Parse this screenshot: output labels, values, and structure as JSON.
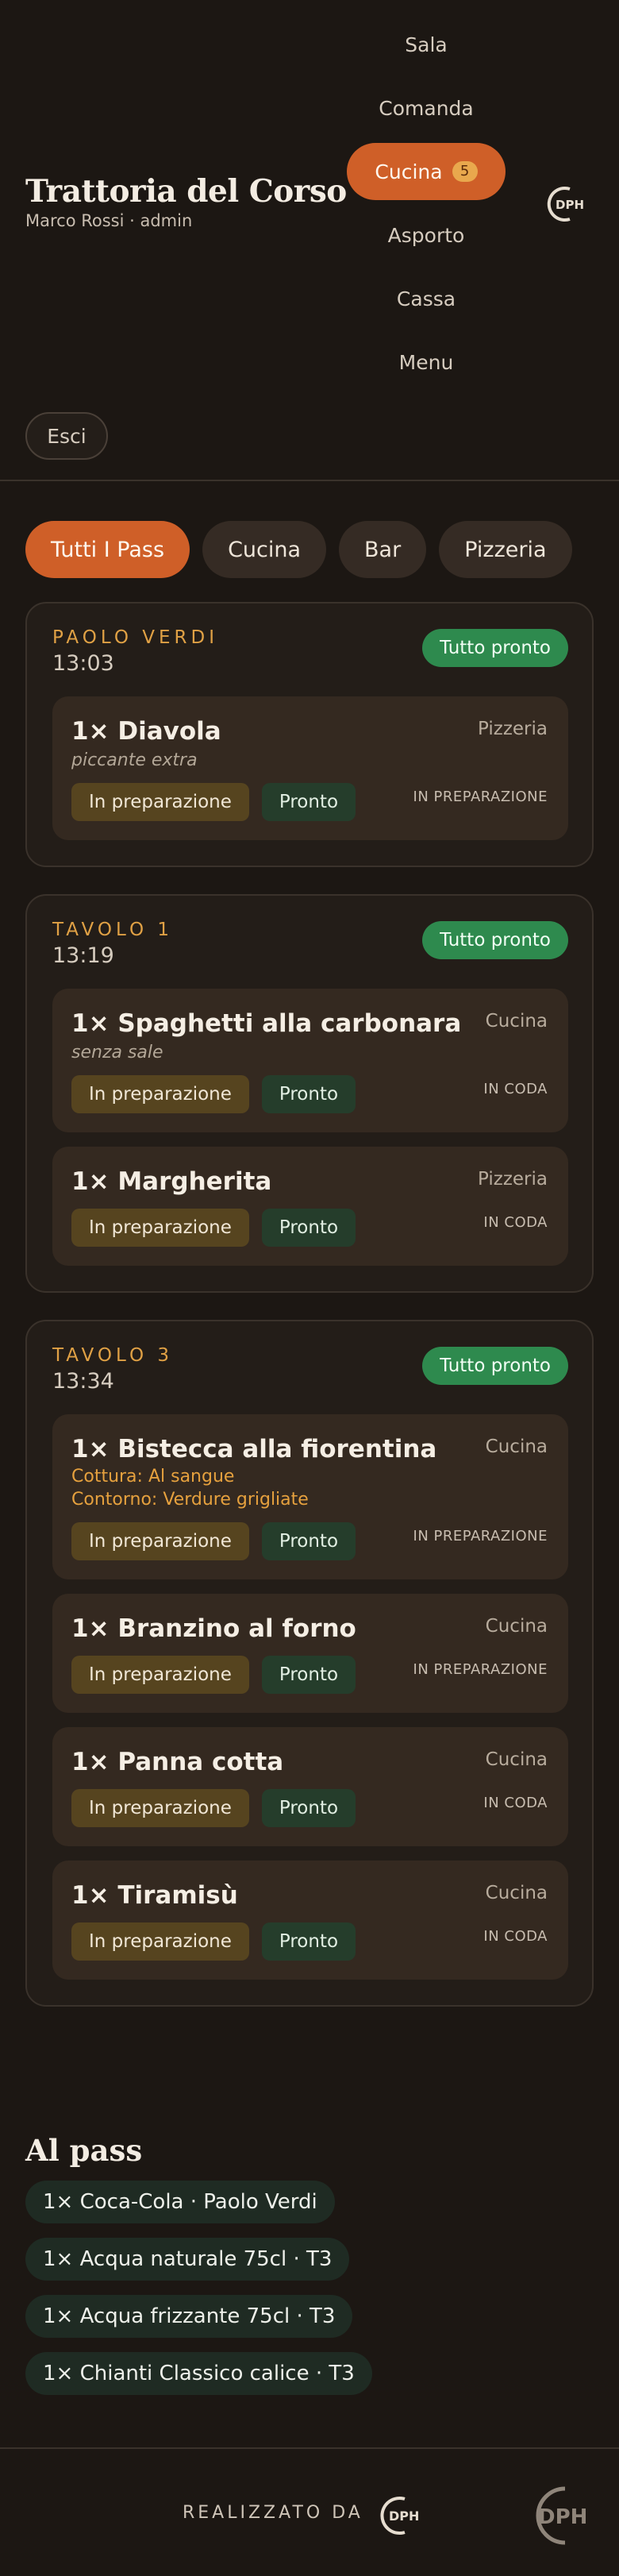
{
  "header": {
    "title": "Trattoria del Corso",
    "user": "Marco Rossi · admin",
    "nav": [
      {
        "label": "Sala"
      },
      {
        "label": "Comanda"
      },
      {
        "label": "Cucina",
        "badge": "5"
      },
      {
        "label": "Asporto"
      },
      {
        "label": "Cassa"
      },
      {
        "label": "Menu"
      }
    ],
    "logout_label": "Esci",
    "logo_text": "DPH"
  },
  "filters": [
    "Tutti I Pass",
    "Cucina",
    "Bar",
    "Pizzeria"
  ],
  "colors": {
    "accent": "#cf5f28",
    "success": "#2e8a4e",
    "gold": "#e0a145"
  },
  "orders": [
    {
      "name": "Paolo Verdi",
      "time": "13:03",
      "all_ready_label": "Tutto pronto",
      "items": [
        {
          "title": "1× Diavola",
          "note": "piccante extra",
          "station": "Pizzeria",
          "status": "IN PREPARAZIONE",
          "prep_label": "In preparazione",
          "ready_label": "Pronto"
        }
      ]
    },
    {
      "name": "Tavolo 1",
      "time": "13:19",
      "all_ready_label": "Tutto pronto",
      "items": [
        {
          "title": "1× Spaghetti alla carbonara",
          "note": "senza sale",
          "station": "Cucina",
          "status": "IN CODA",
          "prep_label": "In preparazione",
          "ready_label": "Pronto"
        },
        {
          "title": "1× Margherita",
          "station": "Pizzeria",
          "status": "IN CODA",
          "prep_label": "In preparazione",
          "ready_label": "Pronto"
        }
      ]
    },
    {
      "name": "Tavolo 3",
      "time": "13:34",
      "all_ready_label": "Tutto pronto",
      "items": [
        {
          "title": "1× Bistecca alla fiorentina",
          "mods": [
            "Cottura: Al sangue",
            "Contorno: Verdure grigliate"
          ],
          "station": "Cucina",
          "status": "IN PREPARAZIONE",
          "prep_label": "In preparazione",
          "ready_label": "Pronto"
        },
        {
          "title": "1× Branzino al forno",
          "station": "Cucina",
          "status": "IN PREPARAZIONE",
          "prep_label": "In preparazione",
          "ready_label": "Pronto"
        },
        {
          "title": "1× Panna cotta",
          "station": "Cucina",
          "status": "IN CODA",
          "prep_label": "In preparazione",
          "ready_label": "Pronto"
        },
        {
          "title": "1× Tiramisù",
          "station": "Cucina",
          "status": "IN CODA",
          "prep_label": "In preparazione",
          "ready_label": "Pronto"
        }
      ]
    }
  ],
  "pass": {
    "title": "Al pass",
    "items": [
      "1× Coca-Cola · Paolo Verdi",
      "1× Acqua naturale 75cl · T3",
      "1× Acqua frizzante 75cl · T3",
      "1× Chianti Classico calice · T3"
    ]
  },
  "footer": {
    "text": "REALIZZATO DA",
    "logo_text": "DPH"
  }
}
